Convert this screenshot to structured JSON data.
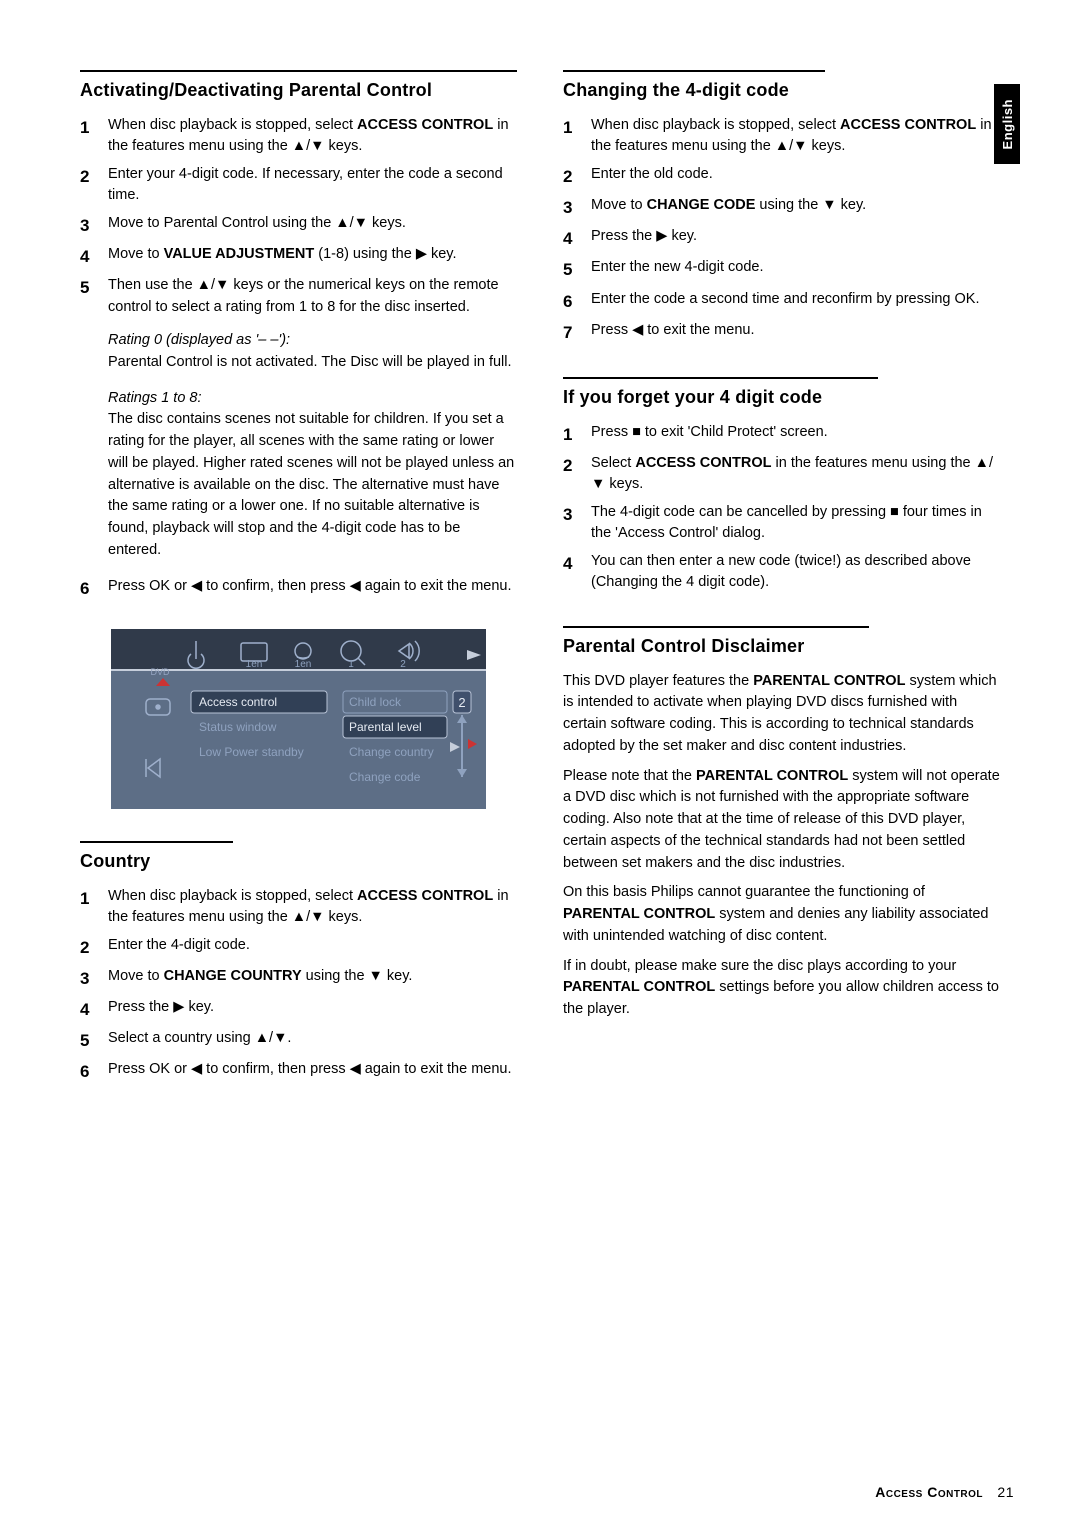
{
  "sideTab": "English",
  "left": {
    "sectionA": {
      "heading": "Activating/Deactivating Parental Control",
      "steps": [
        "When disc playback is stopped, select <b>ACCESS CONTROL</b> in the features menu using the ▲/▼ keys.",
        "Enter your 4-digit code. If necessary, enter the code a second time.",
        "Move to Parental Control using the ▲/▼ keys.",
        "Move to <b>VALUE ADJUSTMENT</b> (1-8) using the ▶ key.",
        "Then use the ▲/▼ keys or the numerical keys on the remote control to select a rating from 1 to 8 for the disc inserted."
      ],
      "rating0_head": "Rating 0 (displayed as '– –'):",
      "rating0_body": "Parental Control is not activated. The Disc will be played in full.",
      "ratings18_head": "Ratings 1 to 8:",
      "ratings18_body": "The disc contains scenes not suitable for children. If you set a rating for the player, all scenes with the same rating or lower will be played. Higher rated scenes will not be played unless an alternative is available on the disc. The alternative must have the same rating or a lower one. If no suitable alternative is found, playback will stop and the 4-digit code has to be entered.",
      "step6": "Press OK or ◀ to confirm, then press ◀ again to exit the menu."
    },
    "menuFig": {
      "iconBar": {
        "label1": "1en",
        "label2": "1en",
        "label3": "1",
        "label4": "2"
      },
      "leftPanelItems": [
        "Access control",
        "Status window",
        "Low Power standby"
      ],
      "rightPanelItems": [
        "Child lock",
        "Parental level",
        "Change country",
        "Change code"
      ],
      "sliderValue": "2"
    },
    "sectionB": {
      "heading": "Country",
      "steps": [
        "When disc playback is stopped, select <b>ACCESS CONTROL</b> in the features menu using the ▲/▼ keys.",
        "Enter the 4-digit code.",
        "Move to <b>CHANGE COUNTRY</b> using the ▼ key.",
        "Press the ▶ key.",
        "Select a country using ▲/▼.",
        "Press OK or ◀ to confirm, then press ◀ again to exit the menu."
      ]
    }
  },
  "right": {
    "sectionC": {
      "heading": "Changing the 4-digit code",
      "steps": [
        "When disc playback is stopped, select <b>ACCESS CONTROL</b> in the features menu using the ▲/▼ keys.",
        "Enter the old code.",
        "Move to <b>CHANGE CODE</b> using the ▼ key.",
        "Press the ▶ key.",
        "Enter the new 4-digit code.",
        "Enter the code a second time and reconfirm by pressing OK.",
        "Press ◀ to exit the menu."
      ]
    },
    "sectionD": {
      "heading": "If you forget your 4 digit code",
      "steps": [
        "Press ■ to exit 'Child Protect' screen.",
        "Select <b>ACCESS CONTROL</b> in the features menu using the ▲/▼ keys.",
        "The 4-digit code can be cancelled by pressing ■ four times in the 'Access Control' dialog.",
        "You can then enter a new code (twice!) as described above (Changing the 4 digit code)."
      ]
    },
    "sectionE": {
      "heading": "Parental Control Disclaimer",
      "paras": [
        "This DVD player features the <b>PARENTAL CONTROL</b> system which is intended to activate when playing DVD discs furnished with certain software coding. This is according to technical standards adopted by the set maker and disc content industries.",
        "Please note that the <b>PARENTAL CONTROL</b> system will not operate a DVD disc which is not furnished with the appropriate software coding. Also note that at the time of release of this DVD player, certain aspects of the technical standards had not been settled between set makers and the disc industries.",
        "On this basis Philips cannot guarantee the functioning of <b>PARENTAL CONTROL</b> system and denies any liability associated with unintended watching of disc content.",
        "If in doubt, please make sure the disc plays according to your <b>PARENTAL CONTROL</b> settings before you allow children access to the player."
      ]
    }
  },
  "footer": {
    "title": "Access Control",
    "page": "21"
  }
}
